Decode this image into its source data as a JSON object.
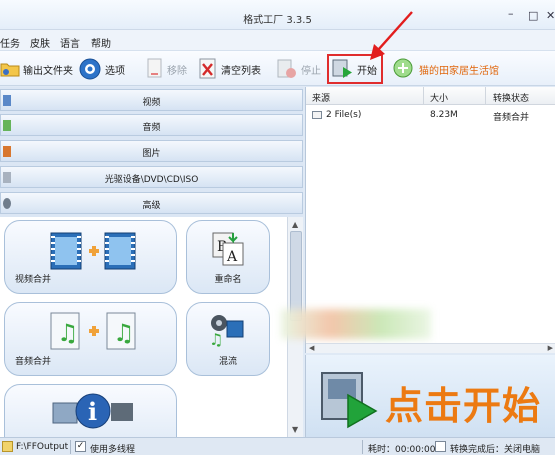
{
  "app": {
    "title": "格式工厂 3.3.5"
  },
  "window_controls": {
    "minimize": "–",
    "maximize": "□",
    "close": "✕"
  },
  "menu": [
    "任务",
    "皮肤",
    "语言",
    "帮助"
  ],
  "toolbar": {
    "output_folder": "输出文件夹",
    "options": "选项",
    "remove": "移除",
    "clear_list": "清空列表",
    "stop": "停止",
    "start": "开始",
    "promo": "猫的田家居生活馆"
  },
  "categories": [
    "视频",
    "音频",
    "图片",
    "光驱设备\\DVD\\CD\\ISO",
    "高级"
  ],
  "tiles": {
    "video_merge": "视频合并",
    "rename": "重命名",
    "audio_merge": "音频合并",
    "mix": "混流"
  },
  "file_table": {
    "headers": [
      "来源",
      "大小",
      "转换状态"
    ],
    "rows": [
      {
        "source": "2 File(s)",
        "size": "8.23M",
        "status": "音频合并"
      }
    ]
  },
  "banner": {
    "text": "点击开始"
  },
  "statusbar": {
    "output_path": "F:\\FFOutput",
    "multithread_label": "使用多线程",
    "multithread_checked": "✓",
    "elapsed": "耗时：00:00:00",
    "after_convert": "转换完成后：关闭电脑"
  },
  "colors": {
    "accent_orange": "#ec7a12",
    "highlight_red": "#e02d2d"
  },
  "icons": [
    "folder-icon",
    "options-icon",
    "remove-icon",
    "clear-list-icon",
    "stop-icon",
    "start-icon",
    "promo-icon"
  ]
}
